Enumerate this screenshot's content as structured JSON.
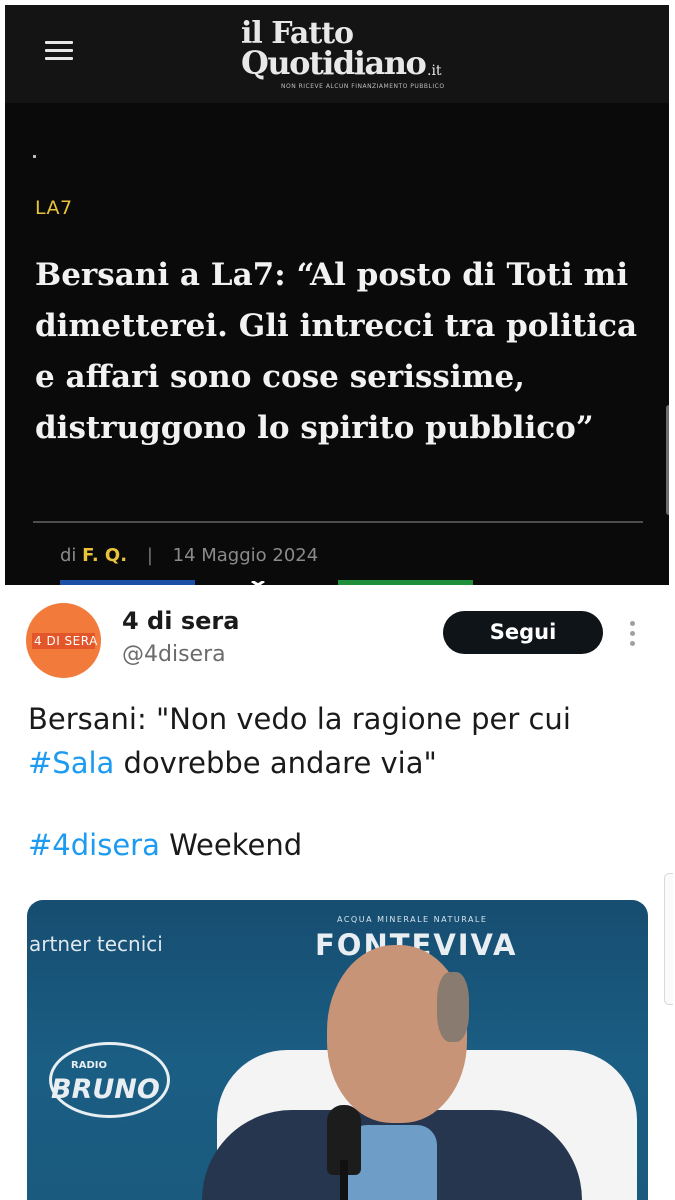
{
  "article": {
    "logo_line1": "il Fatto",
    "logo_line2": "Quotidiano",
    "logo_tld": ".it",
    "logo_tagline": "NON RICEVE ALCUN FINANZIAMENTO PUBBLICO",
    "category": "LA7",
    "headline": "Bersani a La7: “Al posto di Toti mi dimetterei. Gli intrecci tra politica e affari sono cose serissime, distruggono lo spirito pubblico”",
    "by_prefix": "di",
    "author": "F. Q.",
    "separator": "|",
    "date": "14 Maggio 2024",
    "icons": {
      "menu": "hamburger-menu-icon"
    },
    "colors": {
      "background": "#0a0a0a",
      "accent": "#e9c33c",
      "headline": "#f2f2f2"
    }
  },
  "tweet": {
    "display_name": "4 di sera",
    "handle": "@4disera",
    "follow_label": "Segui",
    "avatar_text": "4 DI SERA",
    "text_before": "Bersani: \"Non vedo la ragione per cui ",
    "hashtag1": "#Sala",
    "text_after": " dovrebbe andare via\"",
    "hashtag2": "#4disera",
    "text_end": " Weekend",
    "media": {
      "partner_text": "artner tecnici",
      "sponsor_small": "ACQUA MINERALE NATURALE",
      "sponsor_big": "FONTEVIVA",
      "radio_small": "RADIO",
      "radio_big": "BRUNO"
    },
    "icons": {
      "more": "more-vertical-icon"
    },
    "colors": {
      "hashtag": "#1d9bf0",
      "button": "#0f1419",
      "avatar": "#f27a3a"
    }
  }
}
